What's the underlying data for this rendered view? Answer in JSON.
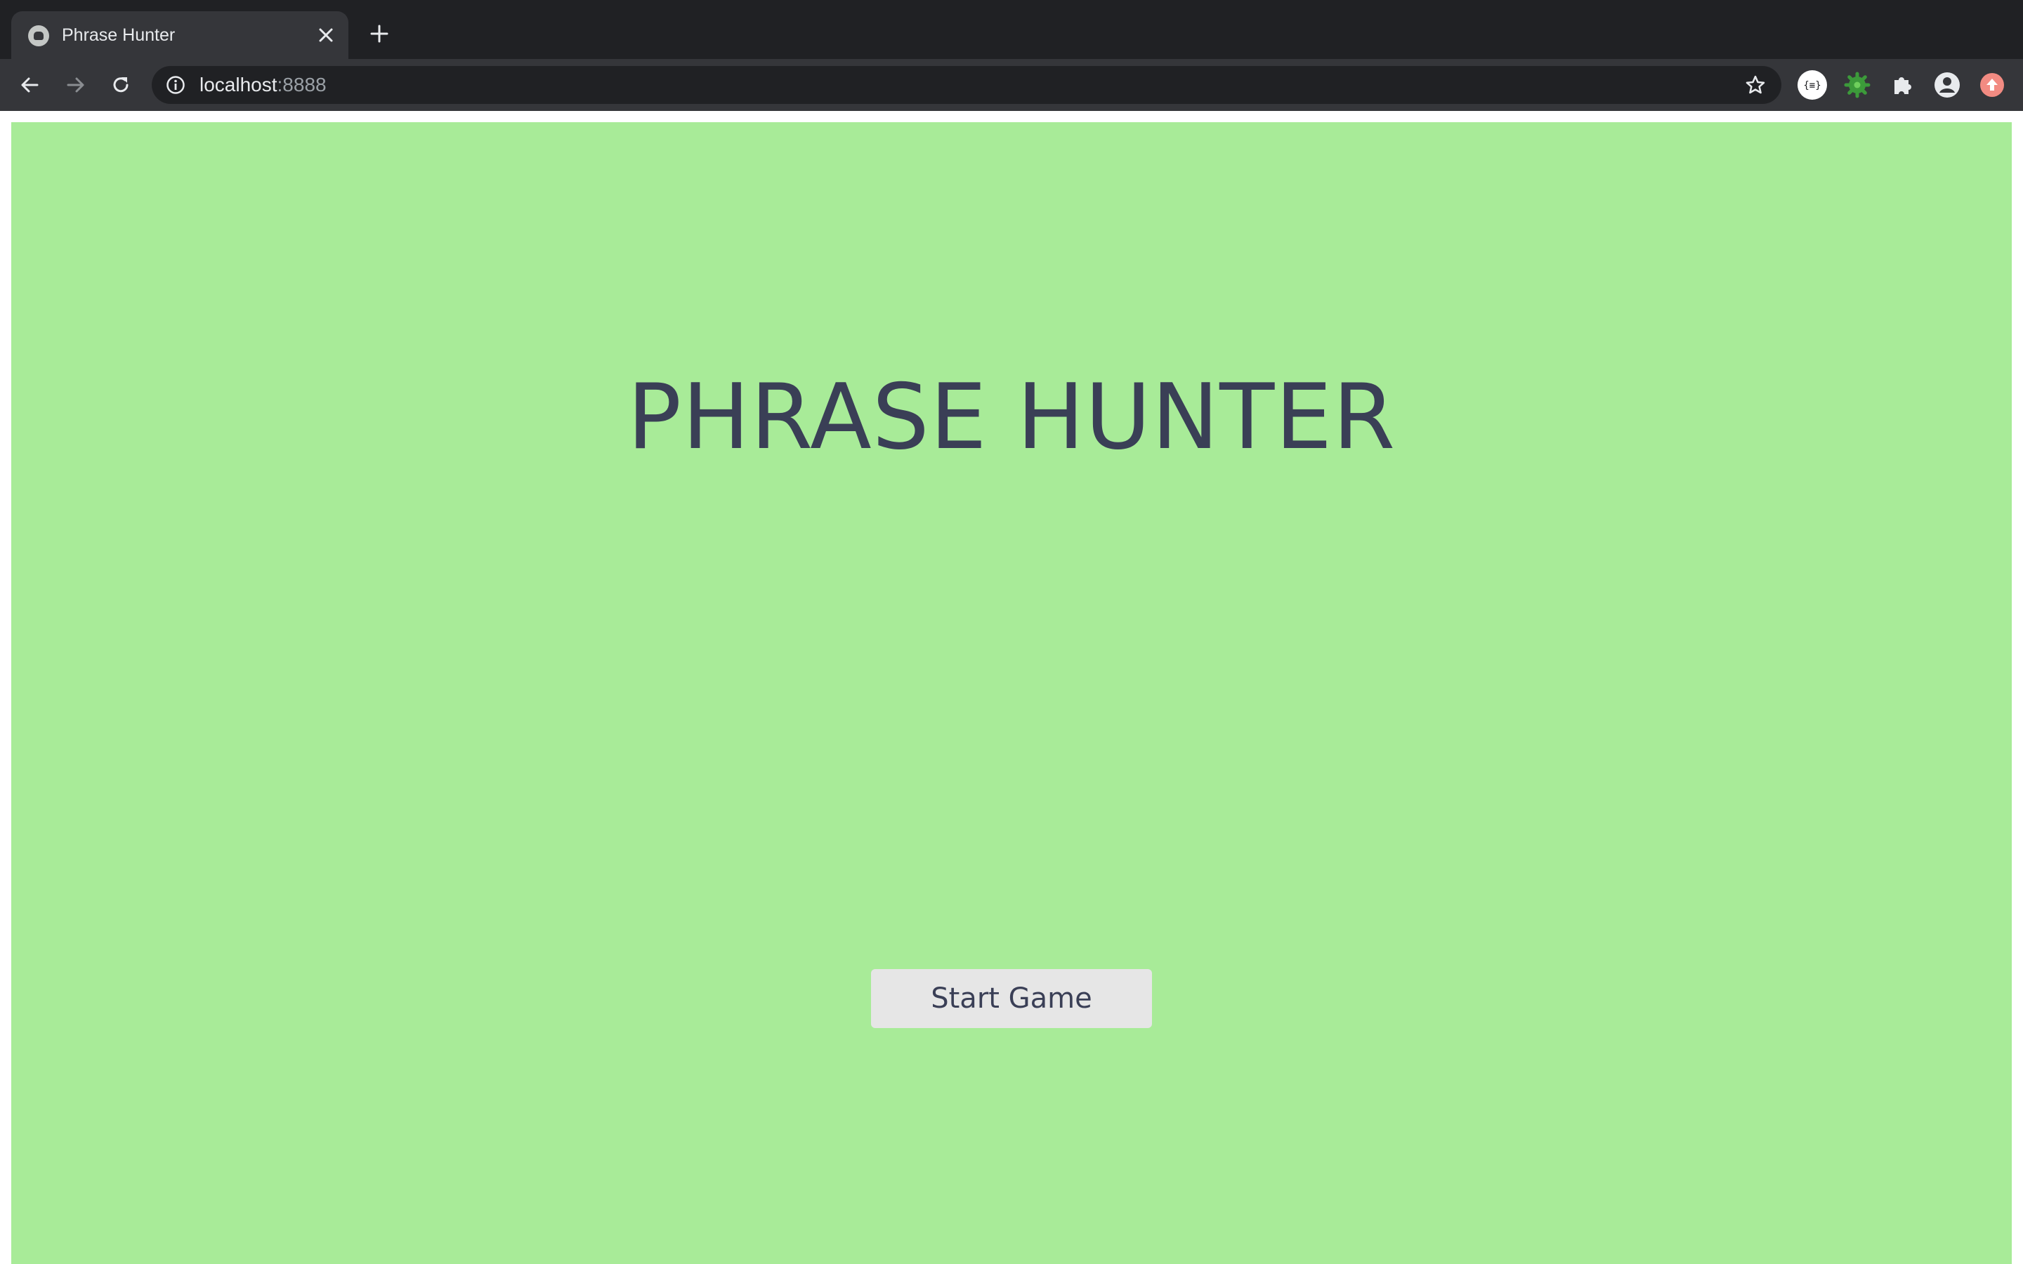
{
  "browser": {
    "tab_title": "Phrase Hunter",
    "url_host": "localhost",
    "url_port": ":8888",
    "icons": {
      "favicon": "elephant-favicon",
      "close": "close-icon",
      "new_tab": "plus-icon",
      "back": "back-arrow-icon",
      "forward": "forward-arrow-icon",
      "reload": "reload-icon",
      "info": "info-icon",
      "bookmark": "star-icon",
      "extensions": [
        "json-viewer-icon",
        "gear-extension-icon",
        "puzzle-icon",
        "profile-icon",
        "update-icon"
      ]
    }
  },
  "page": {
    "title": "PHRASE HUNTER",
    "start_button_label": "Start Game",
    "colors": {
      "background": "#a8eb98",
      "text": "#3a3f56",
      "button": "#e6e6e6"
    }
  }
}
